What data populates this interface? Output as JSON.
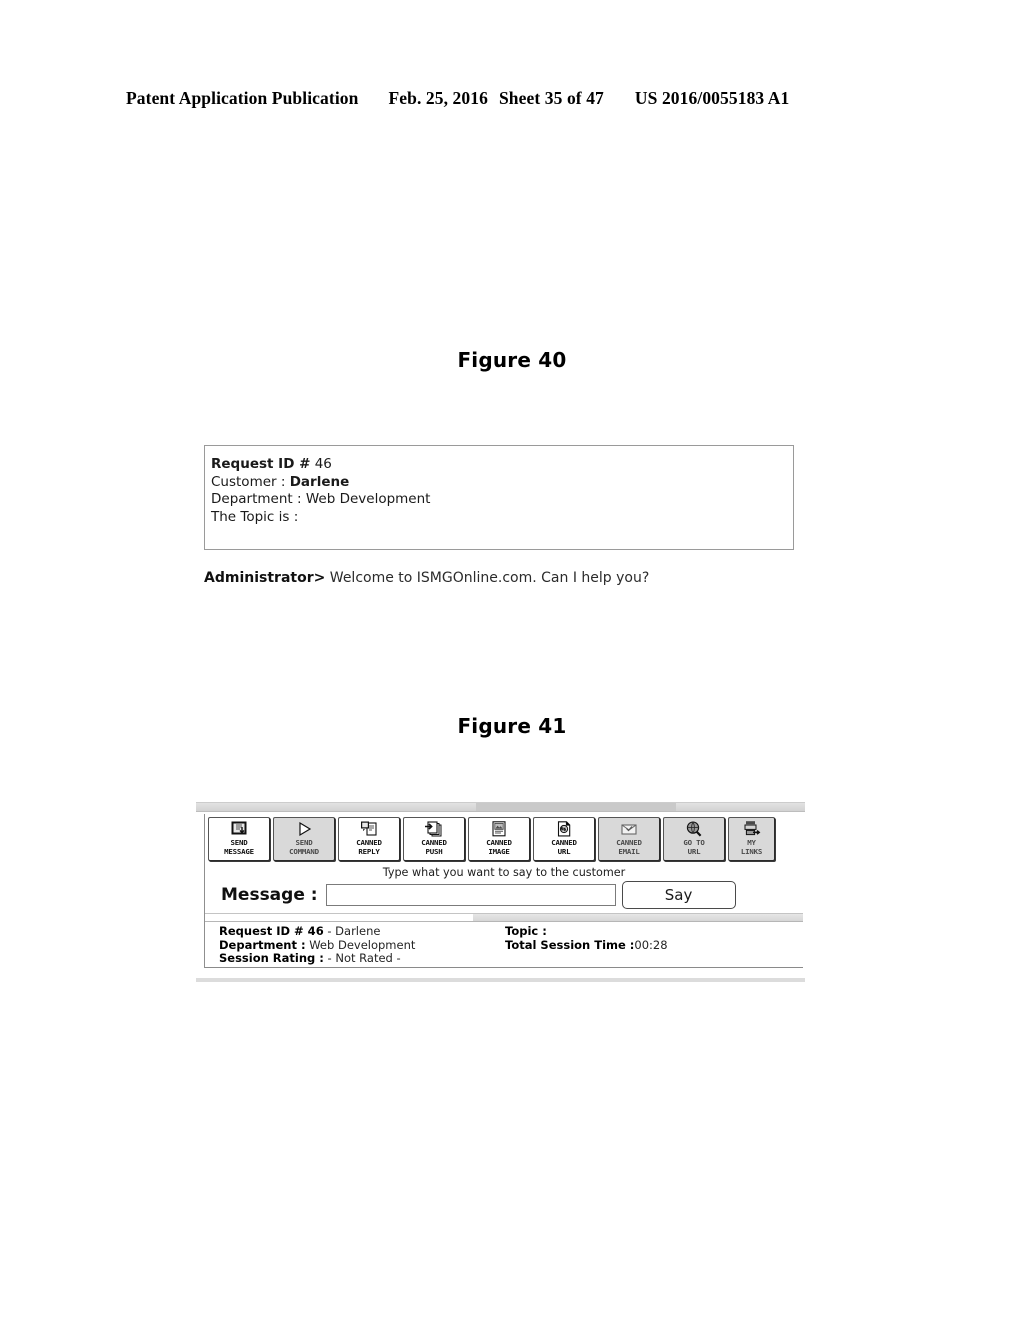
{
  "page_header": {
    "publication": "Patent Application Publication",
    "date": "Feb. 25, 2016",
    "sheet": "Sheet 35 of 47",
    "patent_number": "US 2016/0055183 A1"
  },
  "figure40": {
    "caption": "Figure 40",
    "request_box": {
      "request_id_label": "Request ID #",
      "request_id_value": "46",
      "customer_label": "Customer :",
      "customer_value": "Darlene",
      "department_label": "Department :",
      "department_value": "Web Development",
      "topic_label": "The Topic is :",
      "topic_value": ""
    },
    "transcript": {
      "speaker": "Administrator>",
      "message": " Welcome to ISMGOnline.com. Can I help you?"
    }
  },
  "figure41": {
    "caption": "Figure 41",
    "toolbar": {
      "buttons": [
        {
          "label": "SEND\nMESSAGE",
          "icon": "send-message-icon",
          "state": "active"
        },
        {
          "label": "SEND\nCOMMAND",
          "icon": "play-triangle-icon",
          "state": "dim"
        },
        {
          "label": "CANNED\nREPLY",
          "icon": "canned-reply-icon",
          "state": "active"
        },
        {
          "label": "CANNED\nPUSH",
          "icon": "canned-push-icon",
          "state": "active"
        },
        {
          "label": "CANNED\nIMAGE",
          "icon": "canned-image-icon",
          "state": "active"
        },
        {
          "label": "CANNED\nURL",
          "icon": "canned-url-icon",
          "state": "active"
        },
        {
          "label": "CANNED\nEMAIL",
          "icon": "canned-email-icon",
          "state": "dim"
        },
        {
          "label": "GO TO\nURL",
          "icon": "globe-search-icon",
          "state": "dim"
        },
        {
          "label": "MY\nLINKS",
          "icon": "my-links-icon",
          "state": "dim"
        }
      ]
    },
    "message_row": {
      "hint": "Type what you want to say to the customer",
      "label": "Message :",
      "input_value": "",
      "input_placeholder": "",
      "say_button": "Say"
    },
    "status_bar": {
      "left": [
        {
          "label": "Request ID # 46",
          "value": " - Darlene"
        },
        {
          "label": "Department :",
          "value": " Web Development"
        },
        {
          "label": "Session Rating :",
          "value": " - Not Rated -"
        }
      ],
      "right": [
        {
          "label": "Topic :",
          "value": ""
        },
        {
          "label": "Total Session Time :",
          "value": "00:28"
        }
      ]
    }
  }
}
